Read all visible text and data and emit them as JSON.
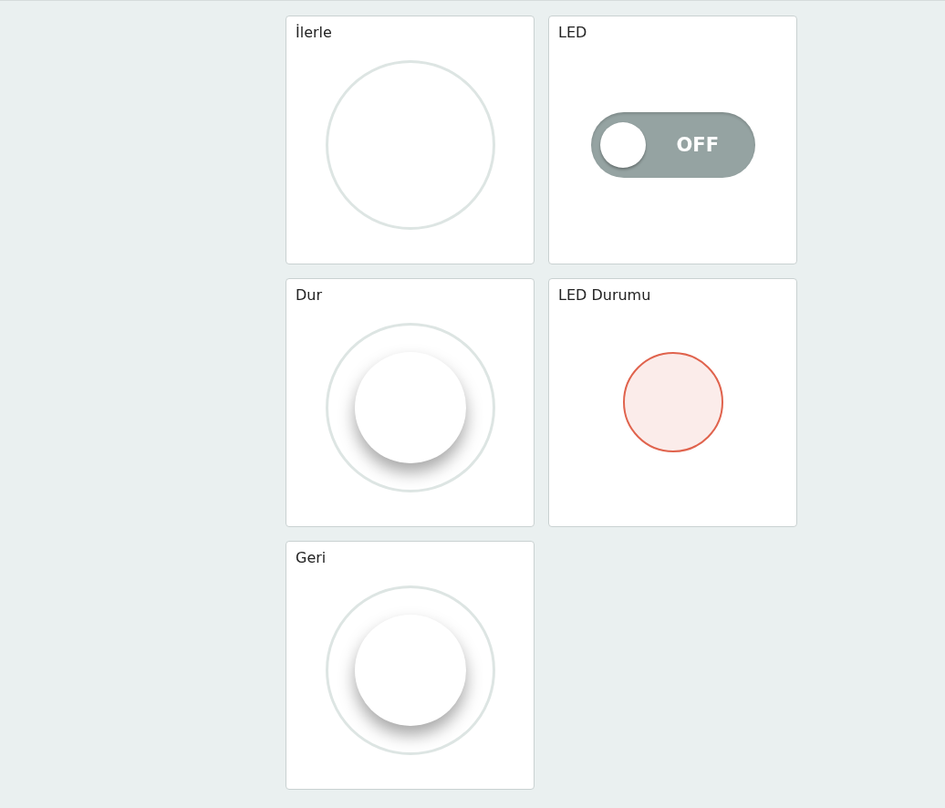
{
  "widgets": [
    {
      "kind": "button",
      "title": "İlerle",
      "pressed": true
    },
    {
      "kind": "switch",
      "title": "LED",
      "on": false,
      "state_label": "OFF"
    },
    {
      "kind": "button",
      "title": "Dur",
      "pressed": false
    },
    {
      "kind": "led",
      "title": "LED Durumu",
      "lit": false
    },
    {
      "kind": "button",
      "title": "Geri",
      "pressed": false
    }
  ]
}
